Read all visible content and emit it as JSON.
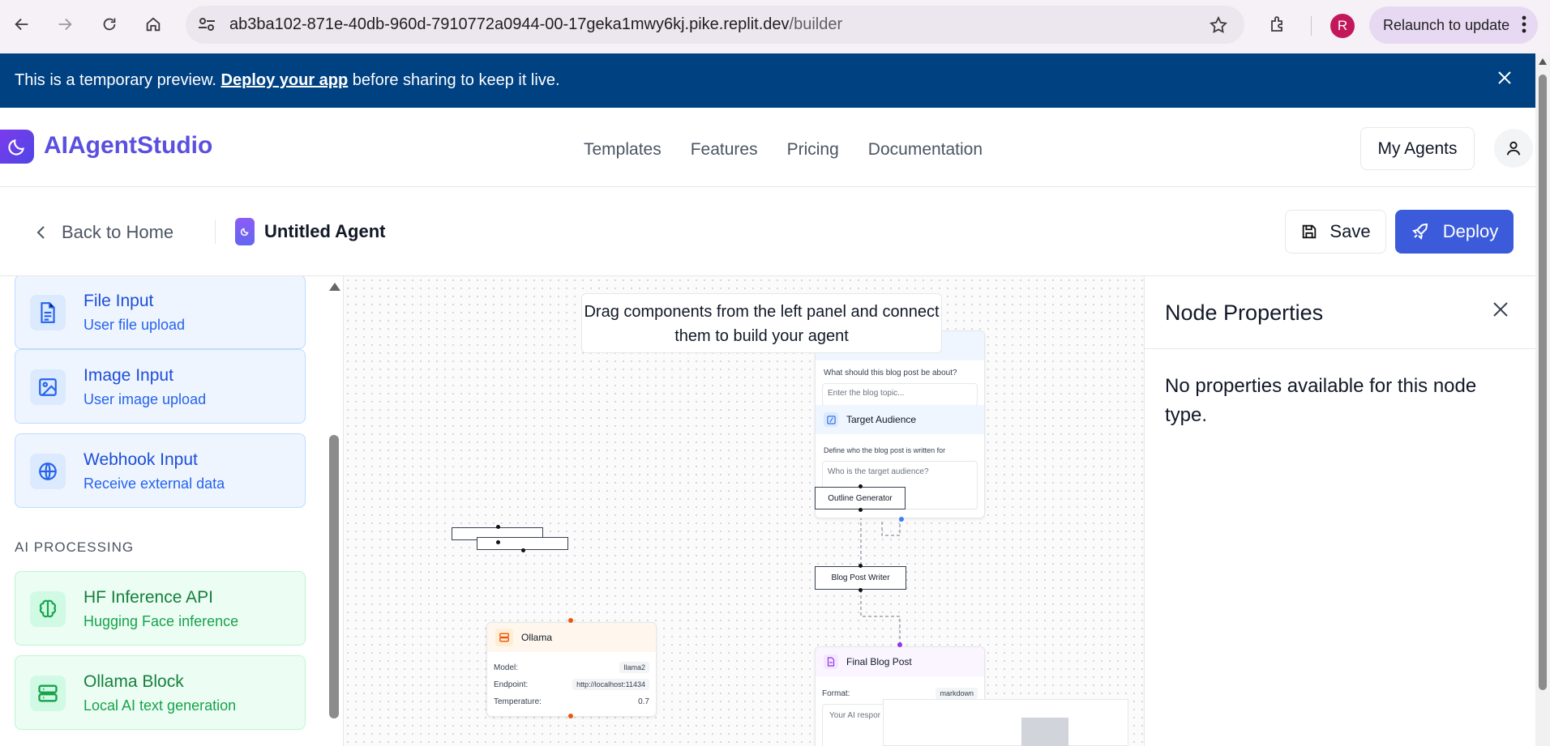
{
  "browser": {
    "url_main": "ab3ba102-871e-40db-960d-7910772a0944-00-17geka1mwy6kj.pike.replit.dev",
    "url_path": "/builder",
    "profile_initial": "R",
    "relaunch_label": "Relaunch to update"
  },
  "banner": {
    "prefix": "This is a temporary preview. ",
    "link": "Deploy your app",
    "suffix": " before sharing to keep it live."
  },
  "header": {
    "brand": "AIAgentStudio",
    "nav": [
      "Templates",
      "Features",
      "Pricing",
      "Documentation"
    ],
    "my_agents": "My Agents"
  },
  "toolbar": {
    "back": "Back to Home",
    "agent_name": "Untitled Agent",
    "save": "Save",
    "deploy": "Deploy",
    "deploy_color": "#3b5bdb"
  },
  "sidebar": {
    "input_cards": [
      {
        "title": "File Input",
        "sub": "User file upload",
        "icon": "file-icon"
      },
      {
        "title": "Image Input",
        "sub": "User image upload",
        "icon": "image-icon"
      },
      {
        "title": "Webhook Input",
        "sub": "Receive external data",
        "icon": "globe-icon"
      }
    ],
    "section_ai": "AI PROCESSING",
    "ai_cards": [
      {
        "title": "HF Inference API",
        "sub": "Hugging Face inference",
        "icon": "brain-icon"
      },
      {
        "title": "Ollama Block",
        "sub": "Local AI text generation",
        "icon": "server-icon"
      }
    ]
  },
  "canvas": {
    "hint": "Drag components from the left panel and connect them to build your agent",
    "topic_question": "What should this blog post be about?",
    "topic_placeholder": "Enter the blog topic...",
    "audience_title": "Target Audience",
    "audience_desc": "Define who the blog post is written for",
    "audience_placeholder": "Who is the target audience?",
    "outline_label": "Outline Generator",
    "writer_label": "Blog Post Writer",
    "ollama": {
      "title": "Ollama",
      "model_label": "Model:",
      "model_value": "llama2",
      "endpoint_label": "Endpoint:",
      "endpoint_value": "http://localhost:11434",
      "temp_label": "Temperature:",
      "temp_value": "0.7"
    },
    "final": {
      "title": "Final Blog Post",
      "format_label": "Format:",
      "format_value": "markdown",
      "response_placeholder": "Your AI respor"
    }
  },
  "properties": {
    "title": "Node Properties",
    "empty": "No properties available for this node type."
  }
}
